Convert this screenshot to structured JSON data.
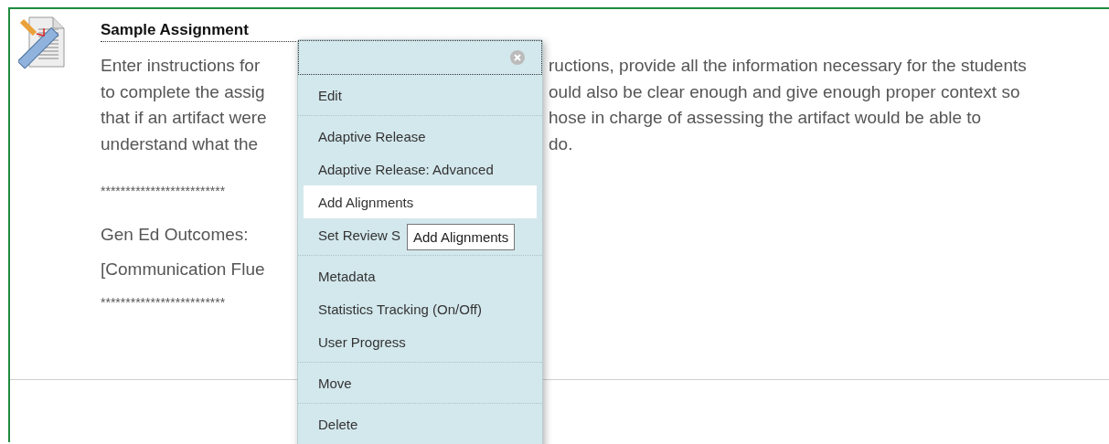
{
  "item": {
    "title": "Sample Assignment",
    "instruction_lines": [
      {
        "left": "Enter instructions for",
        "right": "ructions, provide all the information necessary for the students"
      },
      {
        "left": "to complete the assig",
        "right": "ould also be clear enough and give enough proper context so"
      },
      {
        "left": "that if an artifact were",
        "right": "hose in charge of assessing the artifact would be able to"
      },
      {
        "left": "understand what the",
        "right": "do."
      }
    ],
    "separator": "*************************",
    "outcomes_label": "Gen Ed Outcomes:",
    "outcomes": "[Communication Flue",
    "separator_end": "*************************"
  },
  "context_menu": {
    "groups": [
      [
        {
          "label": "Edit",
          "selected": false
        }
      ],
      [
        {
          "label": "Adaptive Release",
          "selected": false
        },
        {
          "label": "Adaptive Release: Advanced",
          "selected": false
        },
        {
          "label": "Add Alignments",
          "selected": true
        },
        {
          "label": "Set Review S",
          "selected": false
        }
      ],
      [
        {
          "label": "Metadata",
          "selected": false
        },
        {
          "label": "Statistics Tracking (On/Off)",
          "selected": false
        },
        {
          "label": "User Progress",
          "selected": false
        }
      ],
      [
        {
          "label": "Move",
          "selected": false
        }
      ],
      [
        {
          "label": "Delete",
          "selected": false
        }
      ]
    ],
    "tooltip": "Add Alignments"
  }
}
